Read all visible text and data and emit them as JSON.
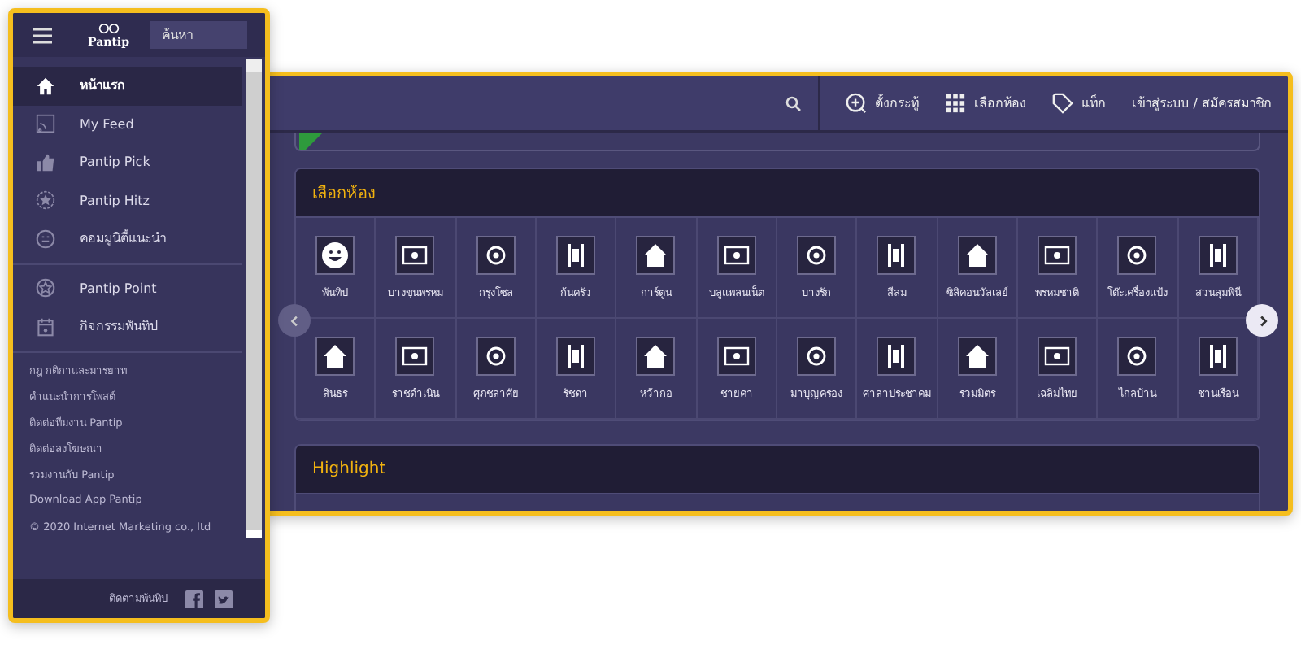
{
  "sidebar": {
    "logo": "Pantip",
    "search": {
      "placeholder": "ค้นหา"
    },
    "menu": [
      {
        "label": "หน้าแรก",
        "selected": true
      },
      {
        "label": "My Feed",
        "selected": false
      },
      {
        "label": "Pantip Pick",
        "selected": false
      },
      {
        "label": "Pantip Hitz",
        "selected": false
      },
      {
        "label": "คอมมูนิตี้แนะนำ",
        "selected": false
      }
    ],
    "menu_2": [
      {
        "label": "Pantip Point",
        "selected": false
      },
      {
        "label": "กิจกรรมพันทิป",
        "selected": false
      }
    ],
    "links": [
      "กฎ กติกาและมารยาท",
      "คำแนะนำการโพสต์",
      "ติดต่อทีมงาน Pantip",
      "ติดต่อลงโฆษณา",
      "ร่วมงานกับ Pantip",
      "Download App Pantip"
    ],
    "copyright": "© 2020 Internet Marketing co., ltd",
    "follow": "ติดตามพันทิป"
  },
  "main": {
    "toolbar": {
      "actions": [
        "ตั้งกระทู้",
        "เลือกห้อง",
        "แท็ก"
      ],
      "login": "เข้าสู่ระบบ / สมัครสมาชิก"
    },
    "rooms_card": {
      "title": "เลือกห้อง",
      "rooms": [
        "พันทิป",
        "บางขุนพรหม",
        "กรุงโซล",
        "ก้นครัว",
        "การ์ตูน",
        "บลูแพลนเน็ต",
        "บางรัก",
        "สีลม",
        "ซิลิคอนวัลเลย์",
        "พรหมชาติ",
        "โต๊ะเครื่องแป้ง",
        "สวนลุมพินี",
        "สินธร",
        "ราชดำเนิน",
        "ศุภชลาศัย",
        "รัชดา",
        "หว้ากอ",
        "ชายคา",
        "มาบุญครอง",
        "ศาลาประชาคม",
        "รวมมิตร",
        "เฉลิมไทย",
        "ไกลบ้าน",
        "ชานเรือน"
      ]
    },
    "highlight": {
      "title": "Highlight"
    }
  }
}
